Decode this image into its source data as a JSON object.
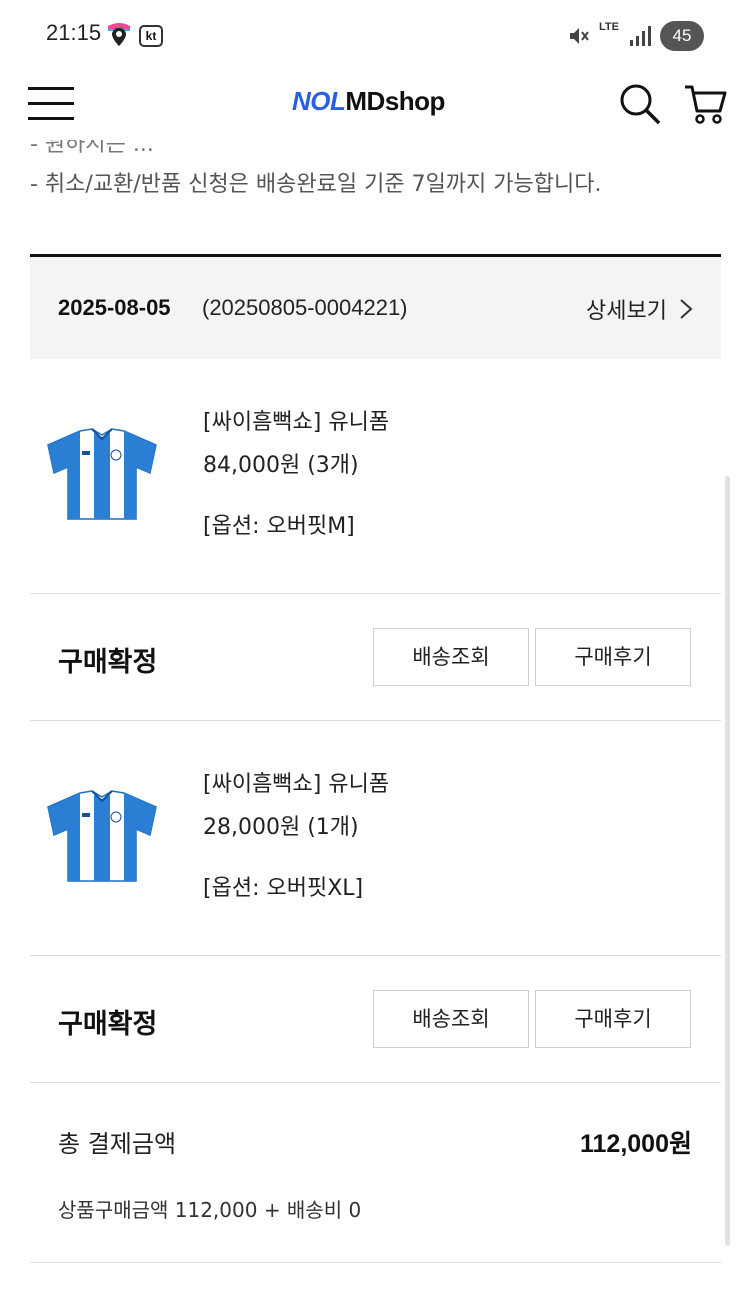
{
  "status_bar": {
    "time": "21:15",
    "carrier_icon_text": "kt",
    "network": "LTE",
    "battery": "45",
    "icons": [
      "map-pin-icon",
      "mute-icon",
      "signal-icon",
      "battery-icon"
    ]
  },
  "header": {
    "logo": {
      "nol": "NOL",
      "md": "MD",
      "shop": "shop"
    },
    "icons": [
      "menu-icon",
      "search-icon",
      "cart-icon"
    ],
    "brand_color": "#2b5fe3"
  },
  "notice": {
    "line_partial": "- 원하시는 ...",
    "line": "- 취소/교환/반품 신청은 배송완료일 기준 7일까지 가능합니다."
  },
  "order": {
    "date": "2025-08-05",
    "number": "(20250805-0004221)",
    "detail_link": "상세보기",
    "items": [
      {
        "name": "[싸이흠뻑쇼] 유니폼",
        "price": "84,000원 (3개)",
        "option": "[옵션: 오버핏M]",
        "status": "구매확정",
        "buttons": {
          "track": "배송조회",
          "review": "구매후기"
        }
      },
      {
        "name": "[싸이흠뻑쇼] 유니폼",
        "price": "28,000원 (1개)",
        "option": "[옵션: 오버핏XL]",
        "status": "구매확정",
        "buttons": {
          "track": "배송조회",
          "review": "구매후기"
        }
      }
    ],
    "total": {
      "label": "총 결제금액",
      "value": "112,000원",
      "breakdown": "상품구매금액 112,000 + 배송비 0"
    }
  }
}
